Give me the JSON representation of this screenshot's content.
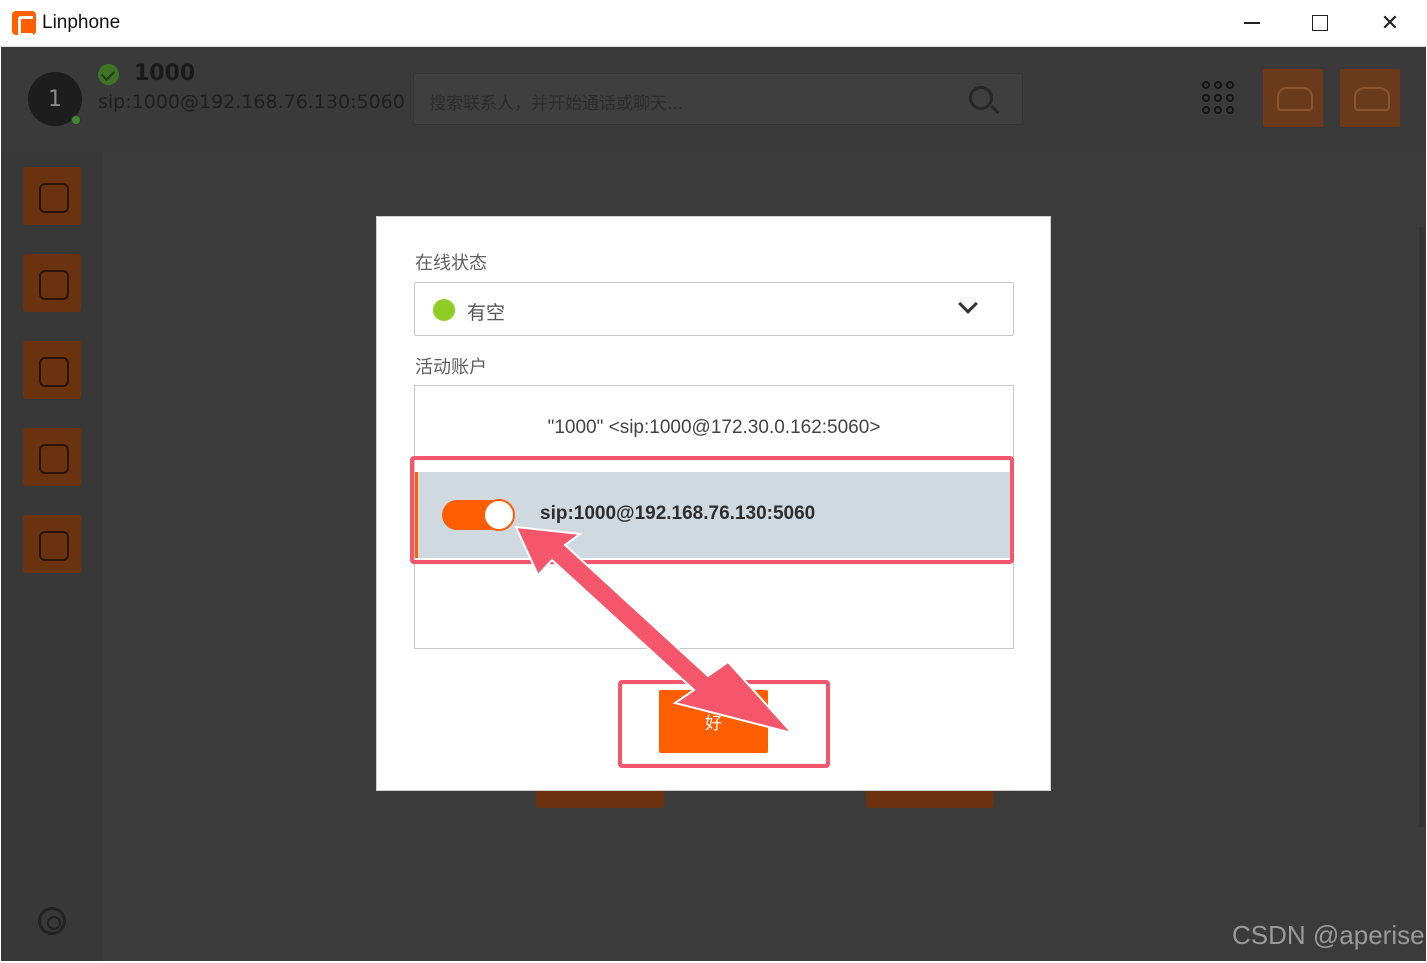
{
  "window": {
    "title": "Linphone"
  },
  "header": {
    "avatar_initial": "1",
    "username": "1000",
    "sip_address": "sip:1000@192.168.76.130:5060",
    "search_placeholder": "搜索联系人，并开始通话或聊天..."
  },
  "dialog": {
    "presence_label": "在线状态",
    "presence_value": "有空",
    "presence_color": "#8fcd25",
    "accounts_label": "活动账户",
    "accounts": [
      {
        "label": "\"1000\" <sip:1000@172.30.0.162:5060>",
        "active": false
      },
      {
        "label": "sip:1000@192.168.76.130:5060",
        "active": true
      }
    ],
    "ok_button": "好"
  },
  "colors": {
    "accent": "#fe5e00",
    "highlight": "#f5566b",
    "selected_row": "#d0d9e0"
  },
  "watermark": "CSDN @aperise"
}
